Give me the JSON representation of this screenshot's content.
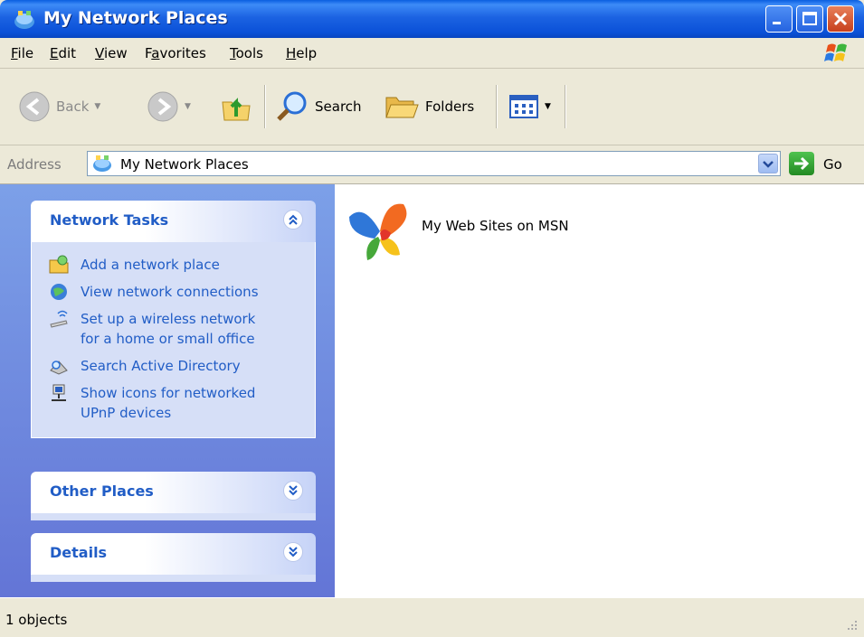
{
  "window": {
    "title": "My Network Places",
    "icon": "network-places-icon"
  },
  "menubar": {
    "items": [
      {
        "label": "File",
        "accel": "F",
        "rest": "ile"
      },
      {
        "label": "Edit",
        "accel": "E",
        "rest": "dit"
      },
      {
        "label": "View",
        "accel": "V",
        "rest": "iew"
      },
      {
        "label": "Favorites",
        "pre": "F",
        "accel": "a",
        "rest": "vorites"
      },
      {
        "label": "Tools",
        "accel": "T",
        "rest": "ools"
      },
      {
        "label": "Help",
        "accel": "H",
        "rest": "elp"
      }
    ]
  },
  "toolbar": {
    "back_label": "Back",
    "search_label": "Search",
    "folders_label": "Folders"
  },
  "address": {
    "label": "Address",
    "value": "My Network Places",
    "go_label": "Go"
  },
  "tasks": {
    "network_tasks_title": "Network Tasks",
    "items": [
      {
        "label": "Add a network place",
        "icon": "add-network-place-icon"
      },
      {
        "label": "View network connections",
        "icon": "network-connections-icon"
      },
      {
        "label": "Set up a wireless network\nfor a home or small office",
        "icon": "wireless-network-icon"
      },
      {
        "label": "Search Active Directory",
        "icon": "search-directory-icon"
      },
      {
        "label": "Show icons for networked\nUPnP devices",
        "icon": "upnp-devices-icon"
      }
    ],
    "other_places_title": "Other Places",
    "details_title": "Details"
  },
  "content": {
    "items": [
      {
        "label": "My Web Sites on MSN",
        "icon": "msn-butterfly-icon"
      }
    ]
  },
  "status": {
    "text": "1 objects"
  },
  "colors": {
    "titlebar": "#0b51d8",
    "task_link": "#215dc6",
    "left_pane": "#7ca0e8"
  }
}
